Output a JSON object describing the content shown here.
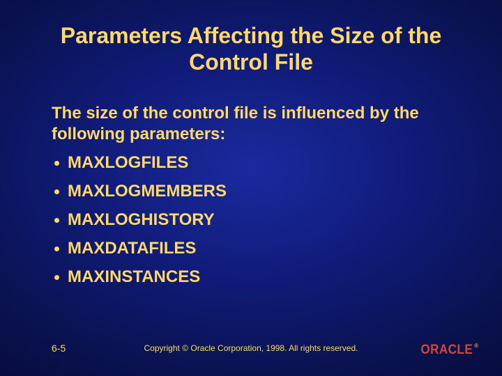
{
  "title": "Parameters Affecting the Size of the Control File",
  "intro": "The size of the control file is influenced by the following parameters:",
  "bullets": [
    "MAXLOGFILES",
    "MAXLOGMEMBERS",
    "MAXLOGHISTORY",
    "MAXDATAFILES",
    "MAXINSTANCES"
  ],
  "footer": {
    "slide_number": "6-5",
    "copyright": "Copyright © Oracle Corporation, 1998. All rights reserved.",
    "logo_text": "ORACLE",
    "registered": "®"
  }
}
